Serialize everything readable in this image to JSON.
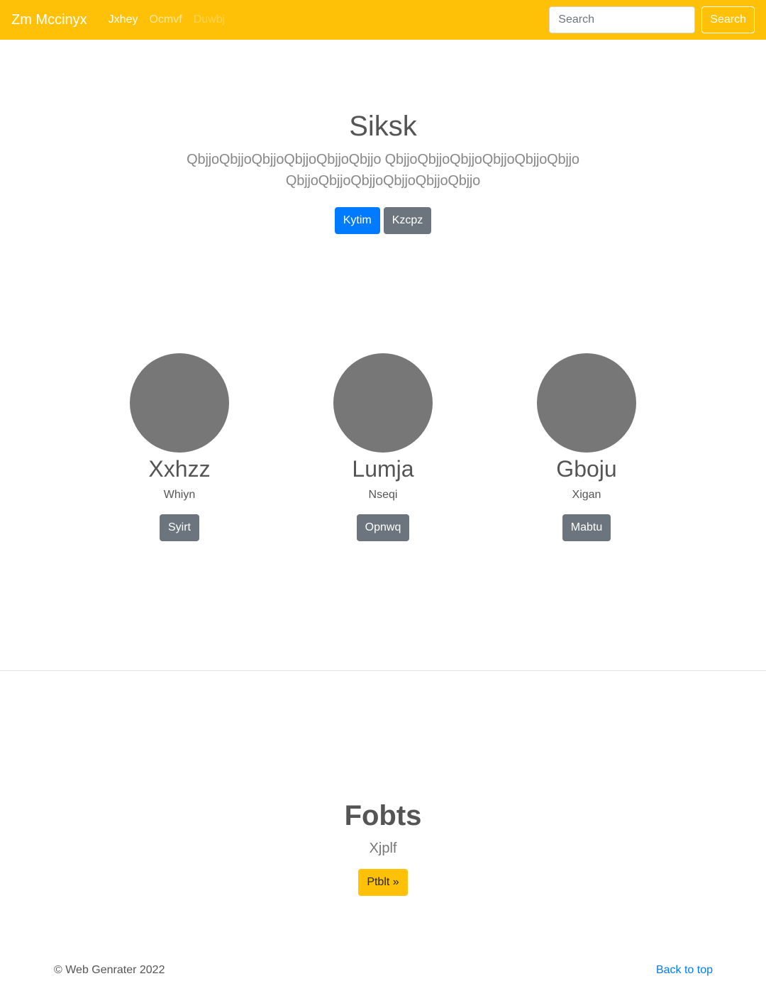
{
  "navbar": {
    "brand": "Zm Mccinyx",
    "links": [
      {
        "label": "Jxhey"
      },
      {
        "label": "Ocmvf"
      },
      {
        "label": "Duwbj"
      }
    ],
    "search_placeholder": "Search",
    "search_button": "Search",
    "color": "#ffc107"
  },
  "hero": {
    "title": "Siksk",
    "lead": "QbjjoQbjjoQbjjoQbjjoQbjjoQbjjo QbjjoQbjjoQbjjoQbjjoQbjjoQbjjo QbjjoQbjjoQbjjoQbjjoQbjjoQbjjo",
    "primary_button": "Kytim",
    "secondary_button": "Kzcpz"
  },
  "team": [
    {
      "name": "Xxhzz",
      "role": "Whiyn",
      "button": "Syirt"
    },
    {
      "name": "Lumja",
      "role": "Nseqi",
      "button": "Opnwq"
    },
    {
      "name": "Gboju",
      "role": "Xigan",
      "button": "Mabtu"
    }
  ],
  "feature": {
    "title": "Fobts",
    "subtitle": "Xjplf",
    "button": "Ptblt »"
  },
  "footer": {
    "copyright": "© Web Genrater 2022",
    "back_to_top": "Back to top"
  }
}
